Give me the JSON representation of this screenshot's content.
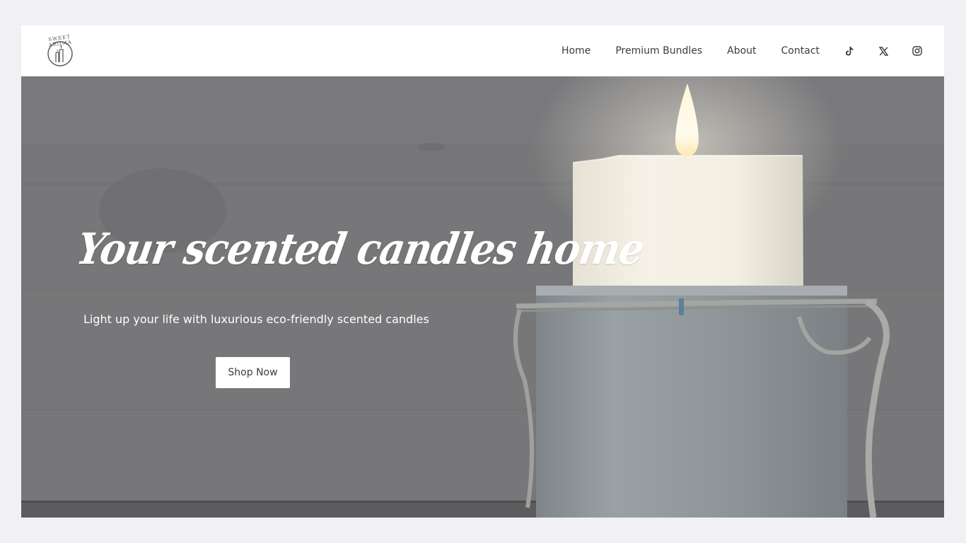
{
  "brand": {
    "logo_text": "SWEET AROMA",
    "logo_icon": "candle-logo-icon"
  },
  "nav": {
    "links": [
      {
        "label": "Home"
      },
      {
        "label": "Premium Bundles"
      },
      {
        "label": "About"
      },
      {
        "label": "Contact"
      }
    ],
    "social": [
      {
        "icon": "tiktok-icon"
      },
      {
        "icon": "x-twitter-icon"
      },
      {
        "icon": "instagram-icon"
      }
    ]
  },
  "hero": {
    "title": "Your scented candles home",
    "subtitle": "Light up your life with luxurious eco-friendly scented candles",
    "cta_label": "Shop Now",
    "image": "lit-white-pillar-candle-on-rope-wrapped-holder"
  },
  "colors": {
    "page_background": "#f1f0f5",
    "nav_background": "#ffffff",
    "nav_text": "#3c3c3c",
    "hero_overlay": "#757577",
    "hero_text": "#ffffff",
    "button_background": "#ffffff"
  }
}
